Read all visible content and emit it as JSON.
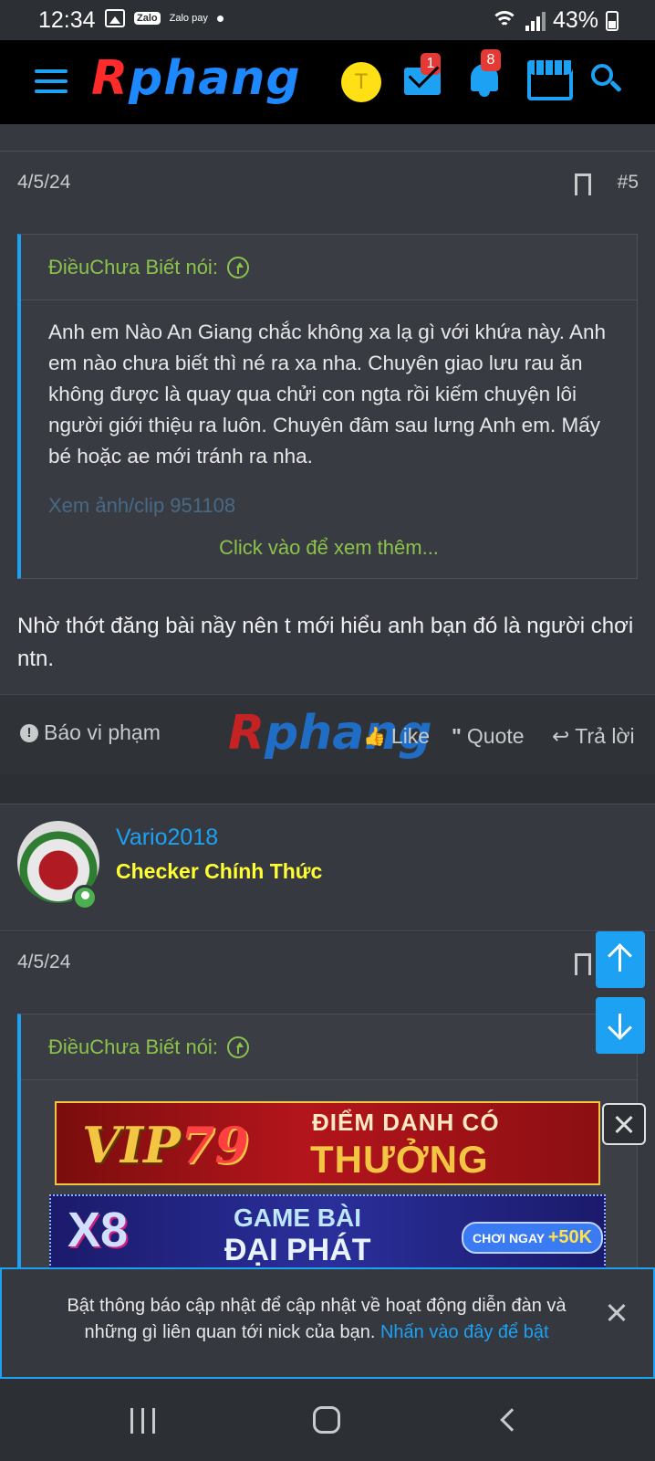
{
  "status_bar": {
    "time": "12:34",
    "zalo_label": "Zalo",
    "zalopay_label": "Zalo pay",
    "battery": "43%"
  },
  "navbar": {
    "logo": "Rphang",
    "logo_first": "R",
    "logo_rest": "phang",
    "avatar_letter": "T",
    "mail_badge": "1",
    "alerts_badge": "8"
  },
  "post1": {
    "date": "4/5/24",
    "post_number": "#5",
    "quote": {
      "author_label": "ĐiềuChưa Biết nói:",
      "text": "Anh em Nào An Giang chắc không xa lạ gì với khứa này. Anh em nào chưa biết thì né ra xa nha. Chuyên giao lưu rau ăn không được là quay qua chửi con ngta rồi kiếm chuyện lôi người giới thiệu ra luôn. Chuyên đâm sau lưng Anh em. Mấy bé hoặc ae mới tránh ra nha.",
      "faded_link": "Xem ảnh/clip 951108",
      "expand_label": "Click vào để xem thêm..."
    },
    "body": "Nhờ thớt đăng bài nầy nên t mới hiểu anh bạn đó là người chơi ntn.",
    "actions": {
      "report": "Báo vi phạm",
      "like": "Like",
      "quote": "Quote",
      "reply": "Trả lời"
    },
    "watermark_first": "R",
    "watermark_rest": "phang"
  },
  "post2": {
    "username": "Vario2018",
    "user_title": "Checker Chính Thức",
    "date": "4/5/24",
    "quote_author_label": "ĐiềuChưa Biết nói:"
  },
  "ads": {
    "ad1_brand_a": "VIP",
    "ad1_brand_b": "79",
    "ad1_line1": "ĐIỂM DANH CÓ",
    "ad1_line2": "THƯỞNG",
    "ad2_brand": "X8",
    "ad2_line1": "GAME BÀI",
    "ad2_line2": "ĐẠI PHÁT",
    "ad2_cta_text": "CHƠI NGAY",
    "ad2_cta_bonus": "+50K"
  },
  "notification": {
    "message": "Bật thông báo cập nhật để cập nhật về hoạt động diễn đàn và những gì liên quan tới nick của bạn.",
    "link": "Nhấn vào đây để bật"
  },
  "colors": {
    "accent": "#1da1f2",
    "quote_author": "#8bc34a",
    "user_title": "#ffff33",
    "background": "#2c2f33"
  }
}
